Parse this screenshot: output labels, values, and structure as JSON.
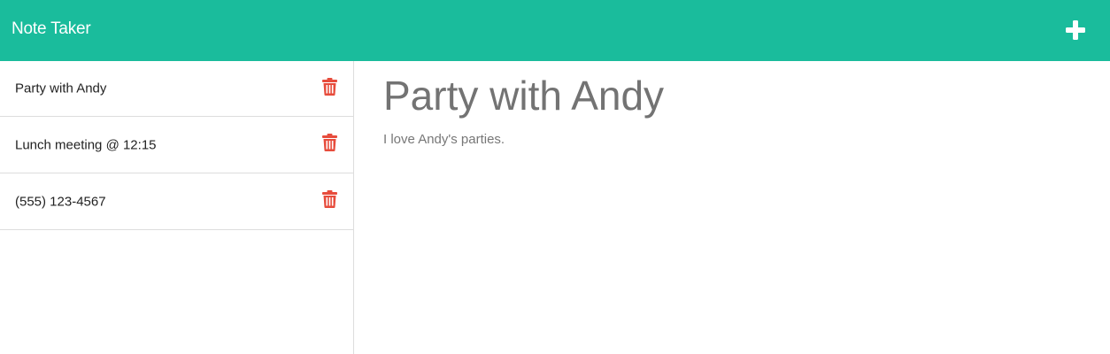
{
  "app": {
    "title": "Note Taker",
    "add_icon": "plus-icon",
    "accent_color": "#1abc9c"
  },
  "sidebar": {
    "delete_icon": "trash-icon",
    "delete_color": "#e74c3c",
    "notes": [
      {
        "title": "Party with Andy"
      },
      {
        "title": "Lunch meeting @ 12:15"
      },
      {
        "title": "(555) 123-4567"
      }
    ]
  },
  "main": {
    "note_title": "Party with Andy",
    "note_text": "I love Andy's parties."
  }
}
